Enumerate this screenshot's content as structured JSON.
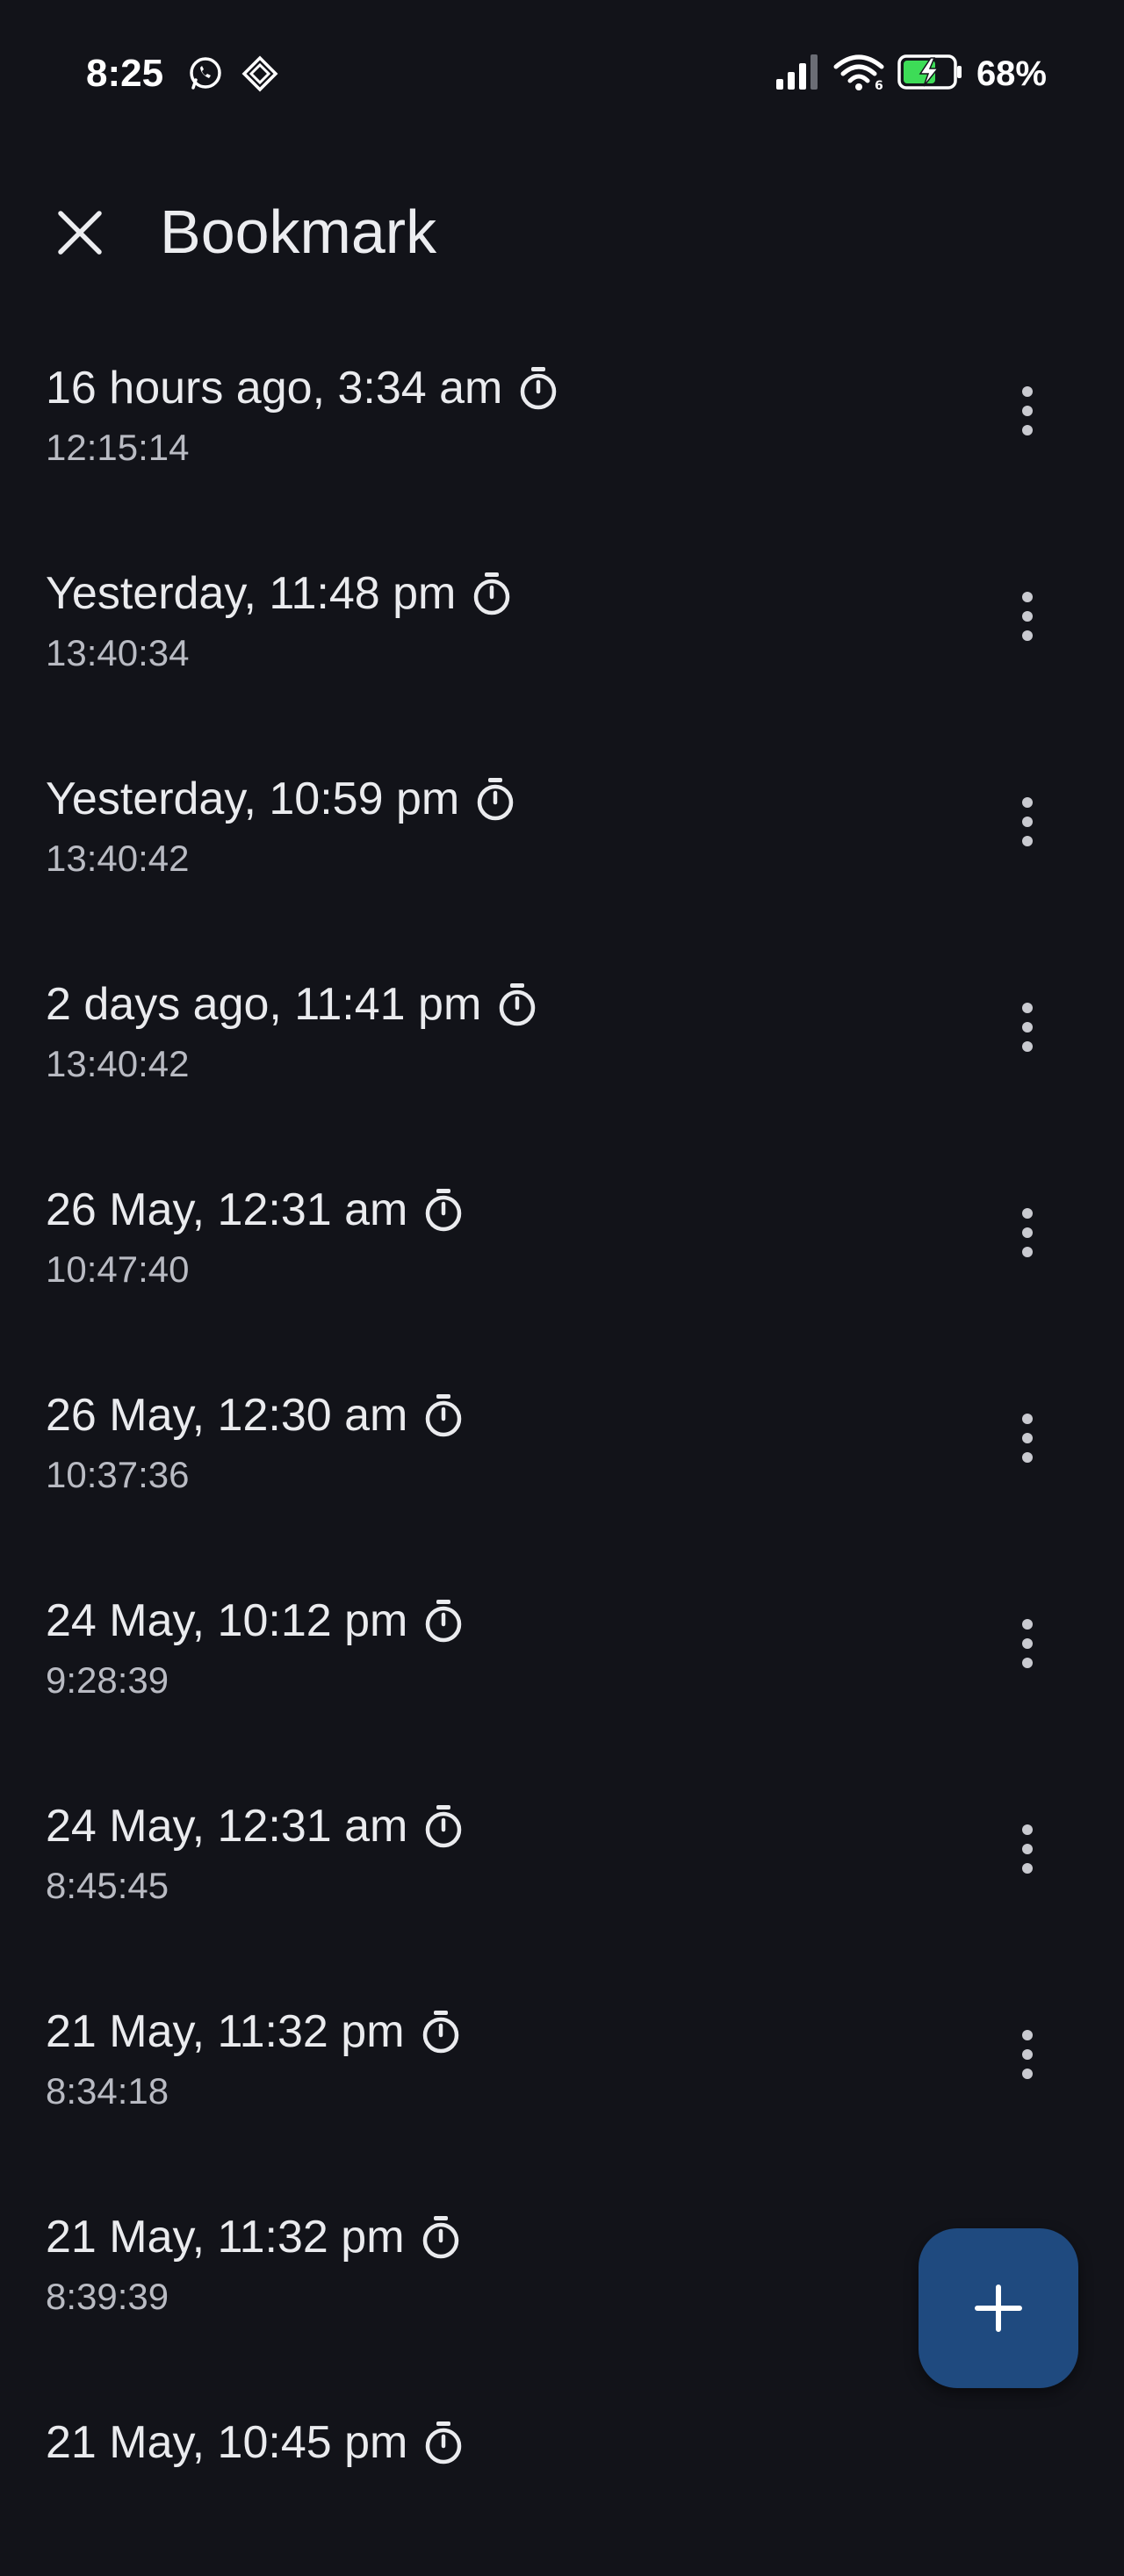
{
  "status_bar": {
    "time": "8:25",
    "battery": "68%",
    "left_icons": [
      "whatsapp-icon",
      "notification-diamond-icon"
    ],
    "right_icons": [
      "signal-icon",
      "wifi-icon",
      "battery-charging-icon"
    ]
  },
  "app_bar": {
    "title": "Bookmark",
    "close_icon": "close-icon"
  },
  "bookmarks": [
    {
      "title": "16 hours ago, 3:34 am",
      "duration": "12:15:14"
    },
    {
      "title": "Yesterday, 11:48 pm",
      "duration": "13:40:34"
    },
    {
      "title": "Yesterday, 10:59 pm",
      "duration": "13:40:42"
    },
    {
      "title": "2 days ago, 11:41 pm",
      "duration": "13:40:42"
    },
    {
      "title": "26 May, 12:31 am",
      "duration": "10:47:40"
    },
    {
      "title": "26 May, 12:30 am",
      "duration": "10:37:36"
    },
    {
      "title": "24 May, 10:12 pm",
      "duration": "9:28:39"
    },
    {
      "title": "24 May, 12:31 am",
      "duration": "8:45:45"
    },
    {
      "title": "21 May, 11:32 pm",
      "duration": "8:34:18"
    },
    {
      "title": "21 May, 11:32 pm",
      "duration": "8:39:39"
    },
    {
      "title": "21 May, 10:45 pm",
      "duration": ""
    }
  ],
  "fab": {
    "icon": "plus-icon"
  },
  "colors": {
    "background": "#121319",
    "fab": "#1f4a7f",
    "battery_green": "#3ddc57"
  }
}
